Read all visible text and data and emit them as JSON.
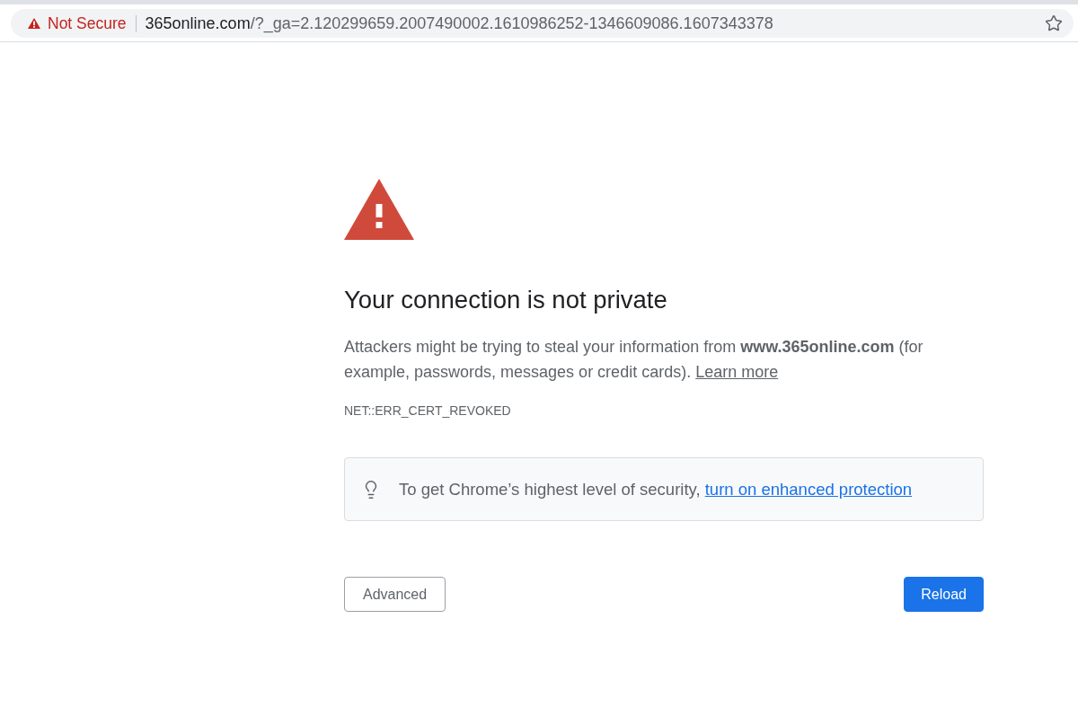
{
  "address_bar": {
    "security_label": "Not Secure",
    "url_host": "365online.com",
    "url_path": "/?_ga=2.120299659.2007490002.1610986252-1346609086.1607343378",
    "bookmarked": false
  },
  "interstitial": {
    "heading": "Your connection is not private",
    "description": "Attackers might be trying to steal your information from **www.365online.com** (for example, passwords, messages or credit cards).",
    "learn_more_link": "Learn more",
    "error_code": "NET::ERR_CERT_REVOKED"
  },
  "tip": {
    "text": "To get Chrome’s highest level of security,",
    "link": "turn on enhanced protection"
  },
  "buttons": [
    {
      "label": "Advanced",
      "kind": "secondary"
    },
    {
      "label": "Reload",
      "kind": "primary"
    }
  ]
}
